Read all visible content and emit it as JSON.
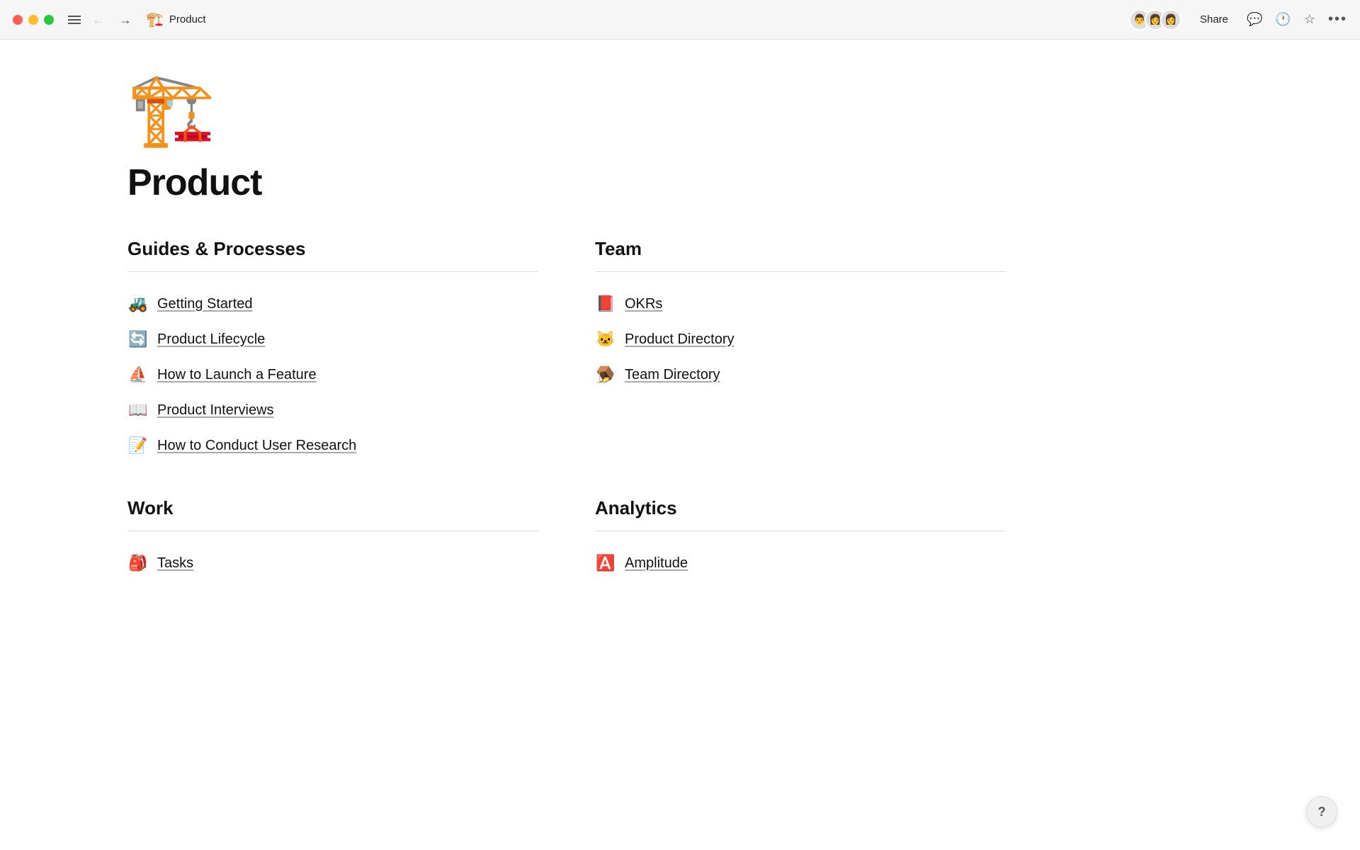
{
  "titlebar": {
    "tab_icon": "🏗️",
    "tab_name": "Product",
    "share_label": "Share",
    "nav_back": "←",
    "nav_forward": "→",
    "more_label": "•••",
    "avatars": [
      "👤",
      "👤",
      "👤"
    ]
  },
  "page": {
    "hero_icon": "🏗️",
    "title": "Product"
  },
  "sections": [
    {
      "id": "guides",
      "title": "Guides & Processes",
      "items": [
        {
          "emoji": "🚜",
          "label": "Getting Started"
        },
        {
          "emoji": "🔄",
          "label": "Product Lifecycle"
        },
        {
          "emoji": "⛵",
          "label": "How to Launch a Feature"
        },
        {
          "emoji": "📖",
          "label": "Product Interviews"
        },
        {
          "emoji": "📝",
          "label": "How to Conduct User Research"
        }
      ]
    },
    {
      "id": "team",
      "title": "Team",
      "items": [
        {
          "emoji": "📕",
          "label": "OKRs"
        },
        {
          "emoji": "🐱",
          "label": "Product Directory"
        },
        {
          "emoji": "🪤",
          "label": "Team Directory"
        }
      ]
    },
    {
      "id": "work",
      "title": "Work",
      "items": [
        {
          "emoji": "🎒",
          "label": "Tasks"
        }
      ]
    },
    {
      "id": "analytics",
      "title": "Analytics",
      "items": [
        {
          "emoji": "🅰️",
          "label": "Amplitude"
        }
      ]
    }
  ],
  "help_label": "?"
}
